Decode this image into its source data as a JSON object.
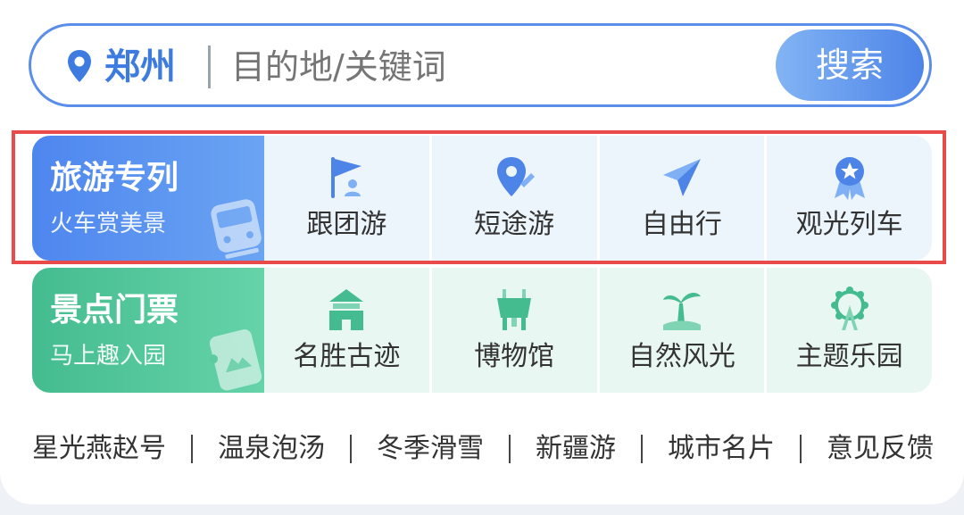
{
  "search": {
    "city": "郑州",
    "placeholder": "目的地/关键词",
    "button_label": "搜索"
  },
  "rows": [
    {
      "title": "旅游专列",
      "subtitle": "火车赏美景",
      "items": [
        {
          "label": "跟团游",
          "icon": "group-tour-flag-icon"
        },
        {
          "label": "短途游",
          "icon": "location-pin-icon"
        },
        {
          "label": "自由行",
          "icon": "paper-plane-icon"
        },
        {
          "label": "观光列车",
          "icon": "badge-star-icon"
        }
      ]
    },
    {
      "title": "景点门票",
      "subtitle": "马上趣入园",
      "items": [
        {
          "label": "名胜古迹",
          "icon": "temple-icon"
        },
        {
          "label": "博物馆",
          "icon": "bronze-vessel-icon"
        },
        {
          "label": "自然风光",
          "icon": "palm-island-icon"
        },
        {
          "label": "主题乐园",
          "icon": "ferris-wheel-icon"
        }
      ]
    }
  ],
  "links": [
    "星光燕赵号",
    "温泉泡汤",
    "冬季滑雪",
    "新疆游",
    "城市名片",
    "意见反馈"
  ],
  "colors": {
    "accent_blue": "#4d84e8",
    "accent_green": "#44bc8f",
    "highlight_red": "#e94b4b"
  }
}
